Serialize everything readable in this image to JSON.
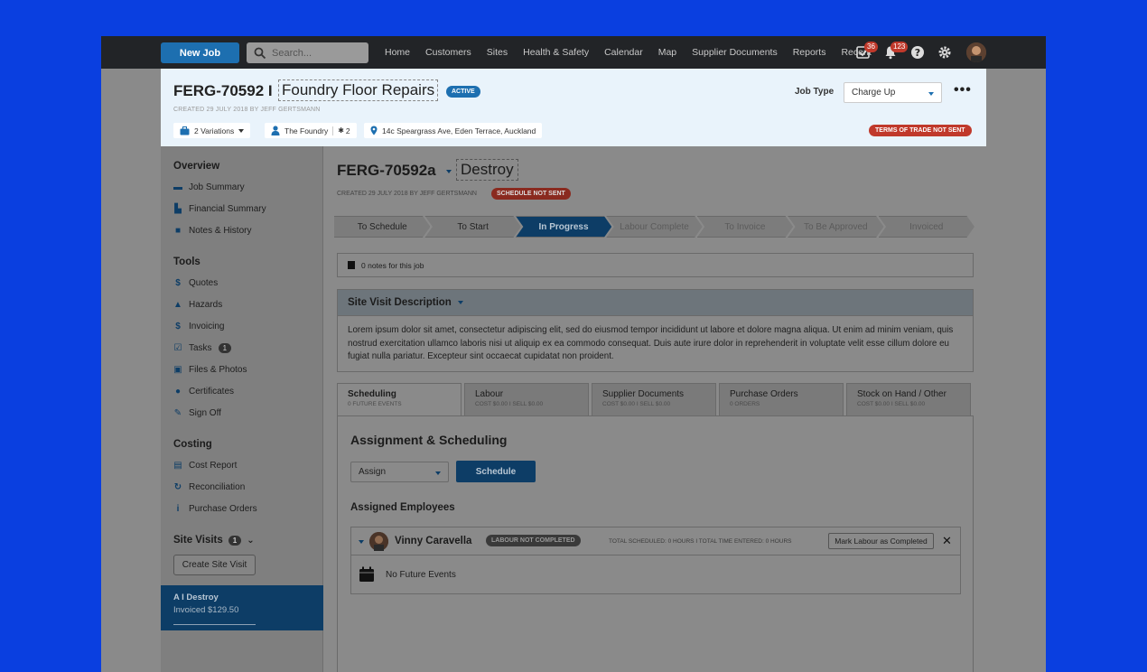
{
  "topbar": {
    "new_job": "New Job",
    "search_placeholder": "Search...",
    "nav": [
      "Home",
      "Customers",
      "Sites",
      "Health & Safety",
      "Calendar",
      "Map",
      "Supplier Documents",
      "Reports",
      "Recent"
    ],
    "tasks_count": "36",
    "notifications_count": "123"
  },
  "header": {
    "job_id": "FERG-70592 I",
    "job_title": "Foundry Floor Repairs",
    "status": "ACTIVE",
    "created": "CREATED 29 JULY 2018 BY JEFF GERTSMANN",
    "job_type_label": "Job Type",
    "job_type_value": "Charge Up",
    "more": "•••",
    "variations": "2 Variations",
    "customer": "The Foundry",
    "contacts": "2",
    "address": "14c Speargrass Ave, Eden Terrace, Auckland",
    "terms": "TERMS OF TRADE NOT SENT"
  },
  "sidebar": {
    "overview_title": "Overview",
    "overview": [
      "Job Summary",
      "Financial Summary",
      "Notes & History"
    ],
    "tools_title": "Tools",
    "tools": [
      "Quotes",
      "Hazards",
      "Invoicing",
      "Tasks",
      "Files & Photos",
      "Certificates",
      "Sign Off"
    ],
    "tasks_count": "1",
    "costing_title": "Costing",
    "costing": [
      "Cost Report",
      "Reconciliation",
      "Purchase Orders"
    ],
    "site_visits_title": "Site Visits",
    "site_visits_count": "1",
    "create_visit": "Create Site Visit",
    "visit_title": "A I Destroy",
    "visit_sub": "Invoiced $129.50"
  },
  "main": {
    "sub_id": "FERG-70592a",
    "sub_title": "Destroy",
    "created": "CREATED 29 JULY 2018 BY JEFF GERTSMANN",
    "schedule_status": "SCHEDULE NOT SENT",
    "stages": [
      "To Schedule",
      "To Start",
      "In Progress",
      "Labour Complete",
      "To Invoice",
      "To Be Approved",
      "Invoiced"
    ],
    "notes": "0 notes for this job",
    "svd_title": "Site Visit Description",
    "svd_text": "Lorem ipsum dolor sit amet, consectetur adipiscing elit, sed do eiusmod tempor incididunt ut labore et dolore magna aliqua. Ut enim ad minim veniam, quis nostrud exercitation ullamco laboris nisi ut aliquip ex ea commodo consequat. Duis aute irure dolor in reprehenderit in voluptate velit esse cillum dolore eu fugiat nulla pariatur. Excepteur sint occaecat cupidatat non proident.",
    "tabs": [
      {
        "label": "Scheduling",
        "sub": "0 FUTURE EVENTS"
      },
      {
        "label": "Labour",
        "sub": "COST $0.00 I SELL $0.00"
      },
      {
        "label": "Supplier Documents",
        "sub": "COST $0.00 I SELL $0.00"
      },
      {
        "label": "Purchase Orders",
        "sub": "0 ORDERS"
      },
      {
        "label": "Stock on Hand / Other",
        "sub": "COST $0.00 I SELL $0.00"
      }
    ],
    "assign_title": "Assignment & Scheduling",
    "assign_value": "Assign",
    "schedule_btn": "Schedule",
    "assigned_title": "Assigned Employees",
    "employee_name": "Vinny Caravella",
    "labour_status": "LABOUR NOT COMPLETED",
    "totals": "TOTAL SCHEDULED: 0 HOURS I TOTAL TIME ENTERED: 0 HOURS",
    "mark_complete": "Mark Labour as Completed",
    "no_events": "No Future Events"
  }
}
